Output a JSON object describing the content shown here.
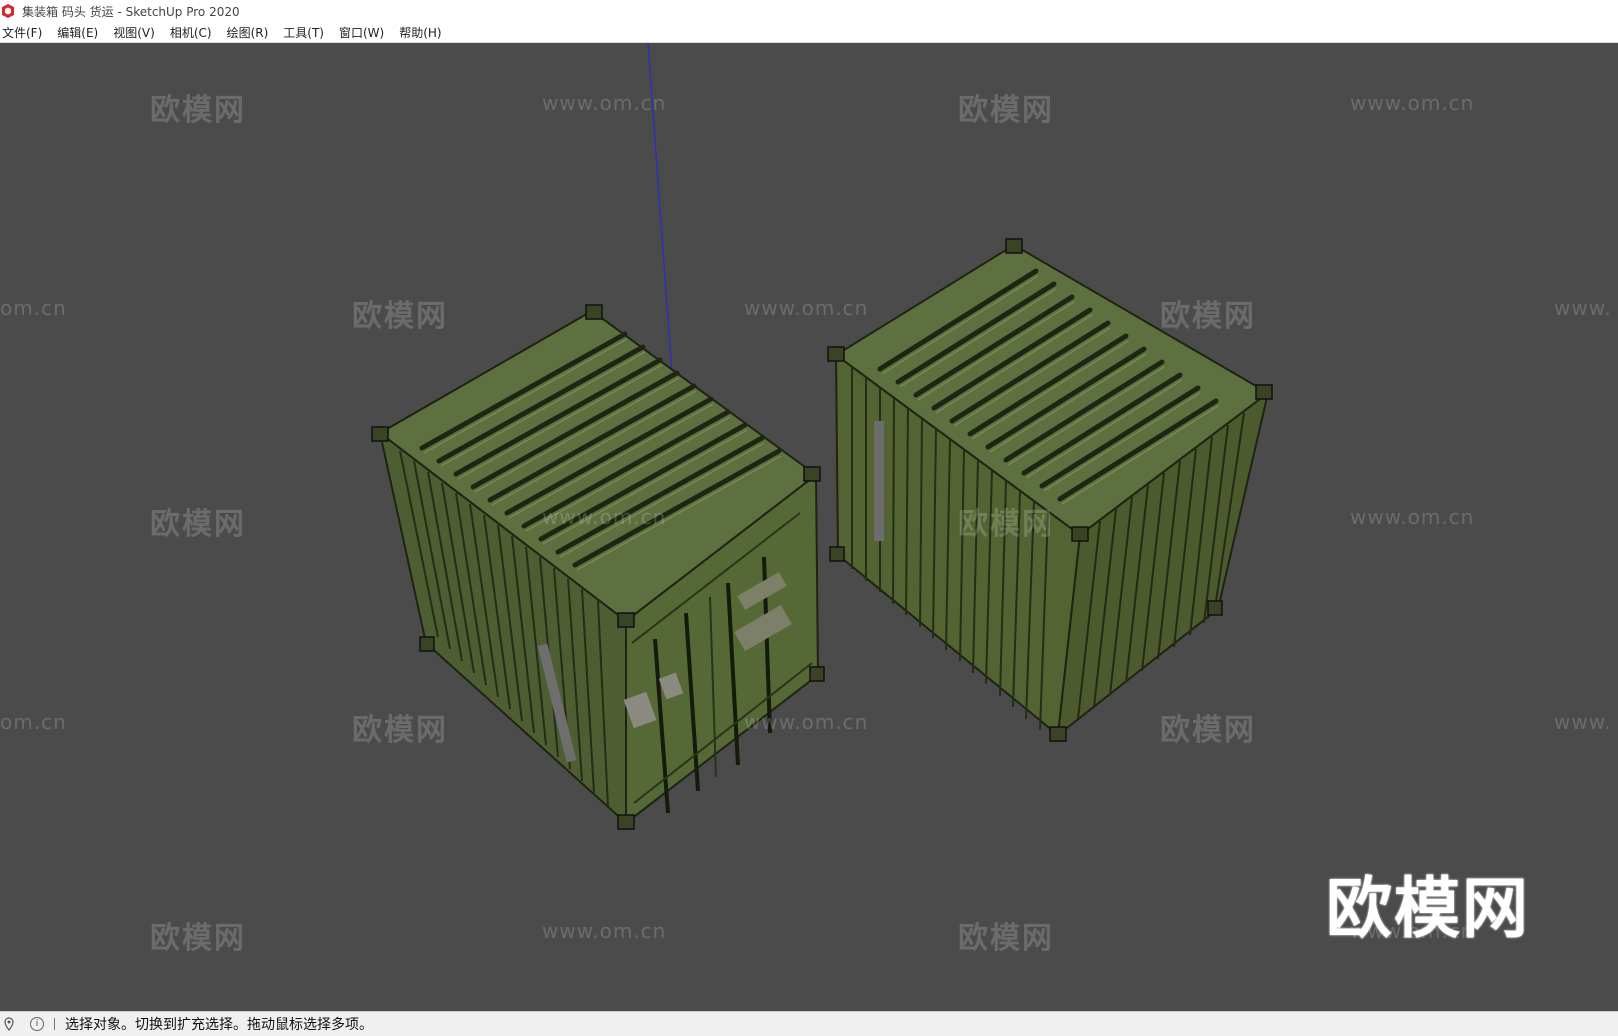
{
  "title": "集装箱 码头 货运 - SketchUp Pro 2020",
  "menu": [
    "文件(F)",
    "编辑(E)",
    "视图(V)",
    "相机(C)",
    "绘图(R)",
    "工具(T)",
    "窗口(W)",
    "帮助(H)"
  ],
  "watermark": {
    "cn": "欧模网",
    "en": "www.om.cn",
    "en_cut_left": "om.cn",
    "en_cut_right": "www."
  },
  "logo": "欧模网",
  "status": {
    "message": "选择对象。切换到扩充选择。拖动鼠标选择多项。",
    "icons": [
      "geo-location-icon",
      "info-icon"
    ]
  },
  "colors": {
    "viewport_bg": "#4b4b4b",
    "container_green": "#5f7040",
    "axis_blue": "#2a2ad0"
  }
}
